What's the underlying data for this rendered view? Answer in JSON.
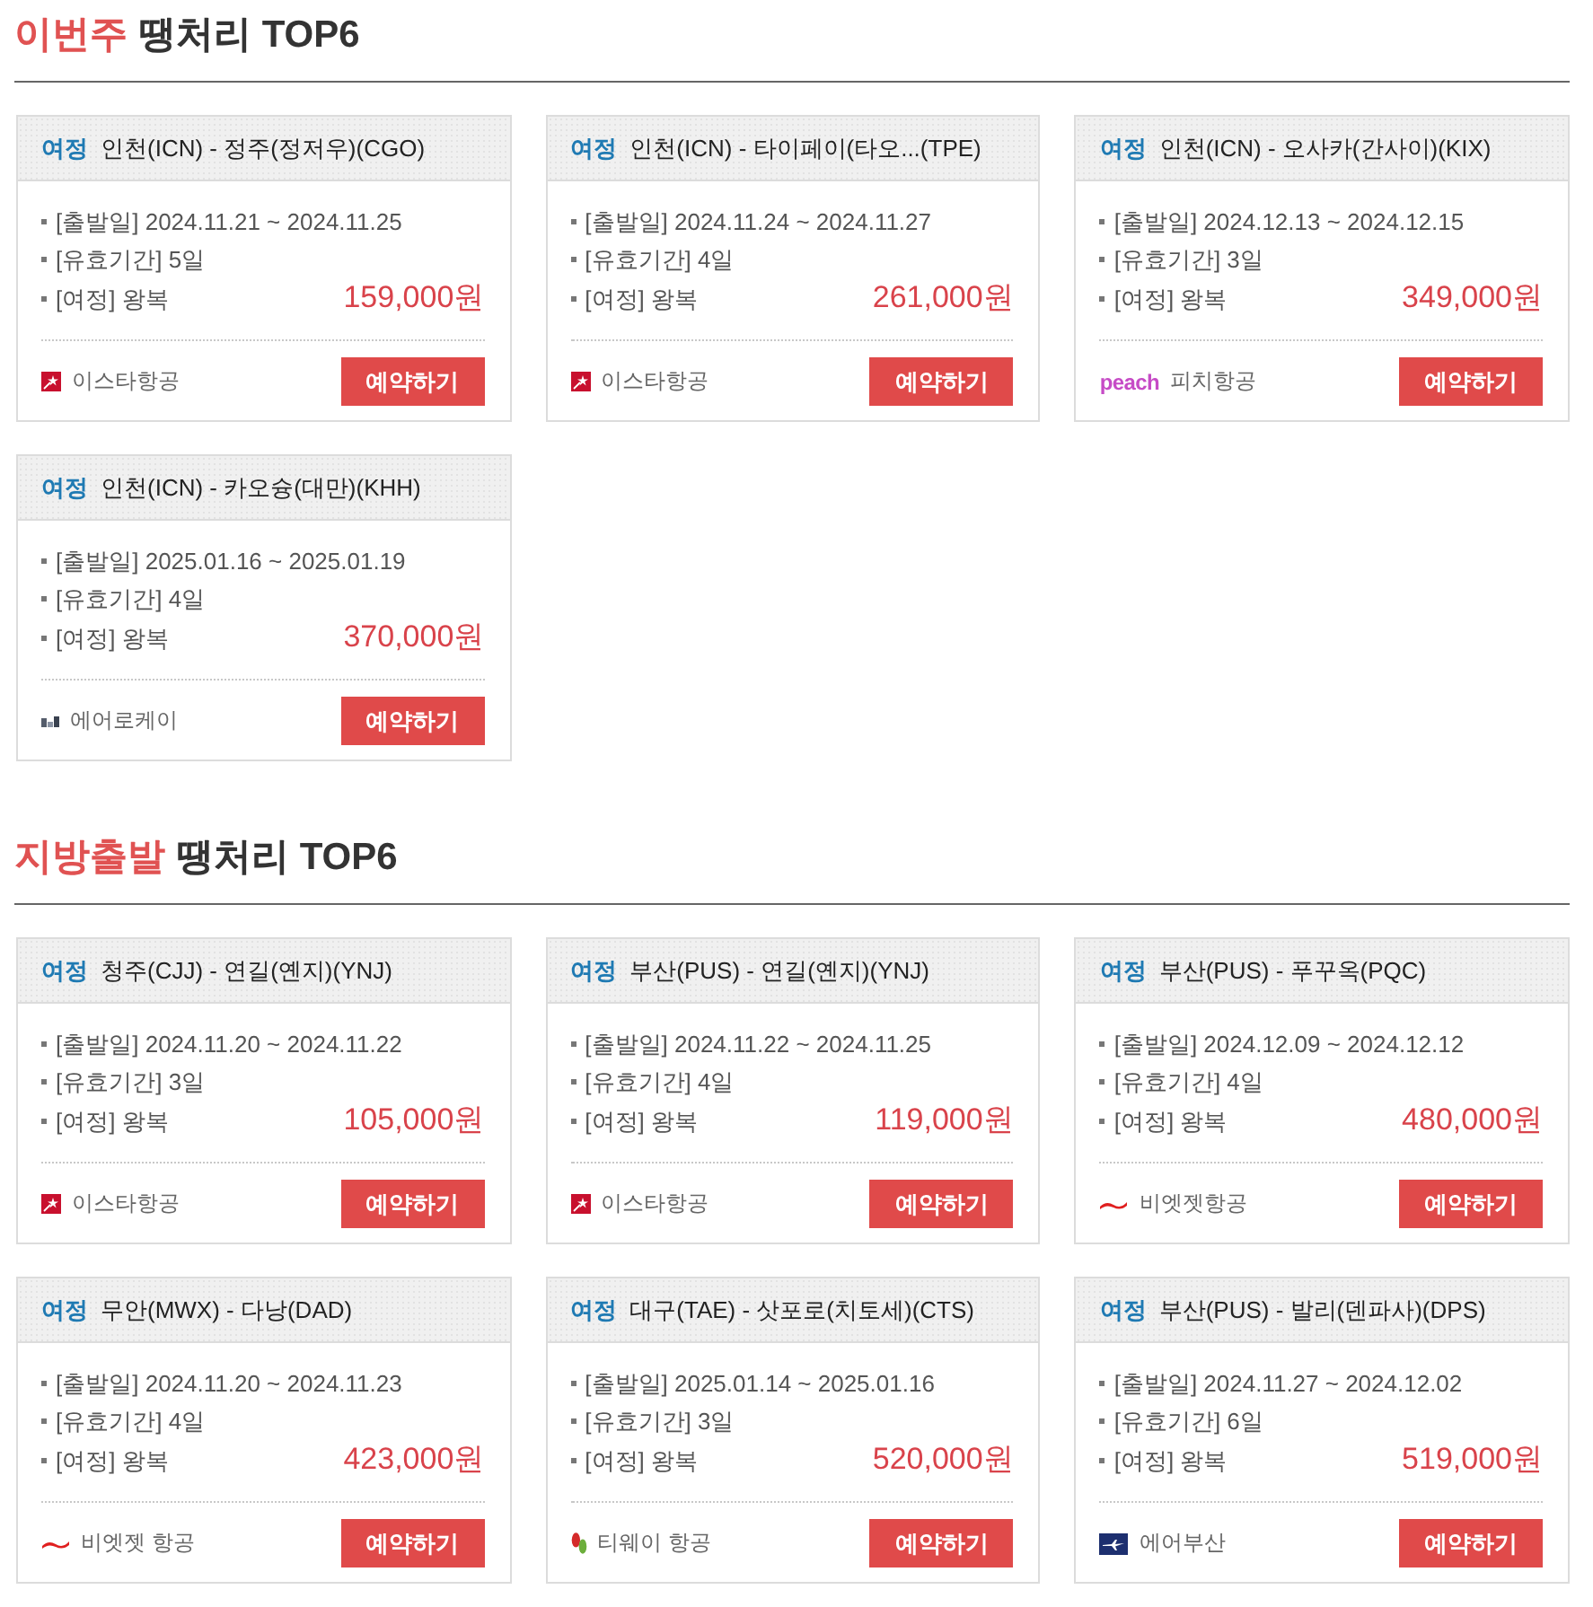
{
  "sections": [
    {
      "title": {
        "highlight": "이번주",
        "text": "땡처리 TOP6"
      },
      "cards": [
        {
          "tag": "여정",
          "route": "인천(ICN) - 정주(정저우)(CGO)",
          "details": [
            "[출발일] 2024.11.21 ~ 2024.11.25",
            "[유효기간] 5일",
            "[여정] 왕복"
          ],
          "price": "159,000원",
          "airline": {
            "name": "이스타항공",
            "kind": "eastar"
          },
          "button": "예약하기"
        },
        {
          "tag": "여정",
          "route": "인천(ICN) - 타이페이(타오...(TPE)",
          "details": [
            "[출발일] 2024.11.24 ~ 2024.11.27",
            "[유효기간] 4일",
            "[여정] 왕복"
          ],
          "price": "261,000원",
          "airline": {
            "name": "이스타항공",
            "kind": "eastar"
          },
          "button": "예약하기"
        },
        {
          "tag": "여정",
          "route": "인천(ICN) - 오사카(간사이)(KIX)",
          "details": [
            "[출발일] 2024.12.13 ~ 2024.12.15",
            "[유효기간] 3일",
            "[여정] 왕복"
          ],
          "price": "349,000원",
          "airline": {
            "name": "피치항공",
            "kind": "peach",
            "logo_text": "peach"
          },
          "button": "예약하기"
        },
        {
          "tag": "여정",
          "route": "인천(ICN) - 카오슝(대만)(KHH)",
          "details": [
            "[출발일] 2025.01.16 ~ 2025.01.19",
            "[유효기간] 4일",
            "[여정] 왕복"
          ],
          "price": "370,000원",
          "airline": {
            "name": "에어로케이",
            "kind": "aerok"
          },
          "button": "예약하기"
        }
      ]
    },
    {
      "title": {
        "highlight": "지방출발",
        "text": "땡처리 TOP6"
      },
      "cards": [
        {
          "tag": "여정",
          "route": "청주(CJJ) - 연길(옌지)(YNJ)",
          "details": [
            "[출발일] 2024.11.20 ~ 2024.11.22",
            "[유효기간] 3일",
            "[여정] 왕복"
          ],
          "price": "105,000원",
          "airline": {
            "name": "이스타항공",
            "kind": "eastar"
          },
          "button": "예약하기"
        },
        {
          "tag": "여정",
          "route": "부산(PUS) - 연길(옌지)(YNJ)",
          "details": [
            "[출발일] 2024.11.22 ~ 2024.11.25",
            "[유효기간] 4일",
            "[여정] 왕복"
          ],
          "price": "119,000원",
          "airline": {
            "name": "이스타항공",
            "kind": "eastar"
          },
          "button": "예약하기"
        },
        {
          "tag": "여정",
          "route": "부산(PUS) - 푸꾸옥(PQC)",
          "details": [
            "[출발일] 2024.12.09 ~ 2024.12.12",
            "[유효기간] 4일",
            "[여정] 왕복"
          ],
          "price": "480,000원",
          "airline": {
            "name": "비엣젯항공",
            "kind": "vietjet"
          },
          "button": "예약하기"
        },
        {
          "tag": "여정",
          "route": "무안(MWX) - 다낭(DAD)",
          "details": [
            "[출발일] 2024.11.20 ~ 2024.11.23",
            "[유효기간] 4일",
            "[여정] 왕복"
          ],
          "price": "423,000원",
          "airline": {
            "name": "비엣젯 항공",
            "kind": "vietjet"
          },
          "button": "예약하기"
        },
        {
          "tag": "여정",
          "route": "대구(TAE) - 삿포로(치토세)(CTS)",
          "details": [
            "[출발일] 2025.01.14 ~ 2025.01.16",
            "[유효기간] 3일",
            "[여정] 왕복"
          ],
          "price": "520,000원",
          "airline": {
            "name": "티웨이 항공",
            "kind": "tway"
          },
          "button": "예약하기"
        },
        {
          "tag": "여정",
          "route": "부산(PUS) - 발리(덴파사)(DPS)",
          "details": [
            "[출발일] 2024.11.27 ~ 2024.12.02",
            "[유효기간] 6일",
            "[여정] 왕복"
          ],
          "price": "519,000원",
          "airline": {
            "name": "에어부산",
            "kind": "airbusan"
          },
          "button": "예약하기"
        }
      ]
    }
  ]
}
